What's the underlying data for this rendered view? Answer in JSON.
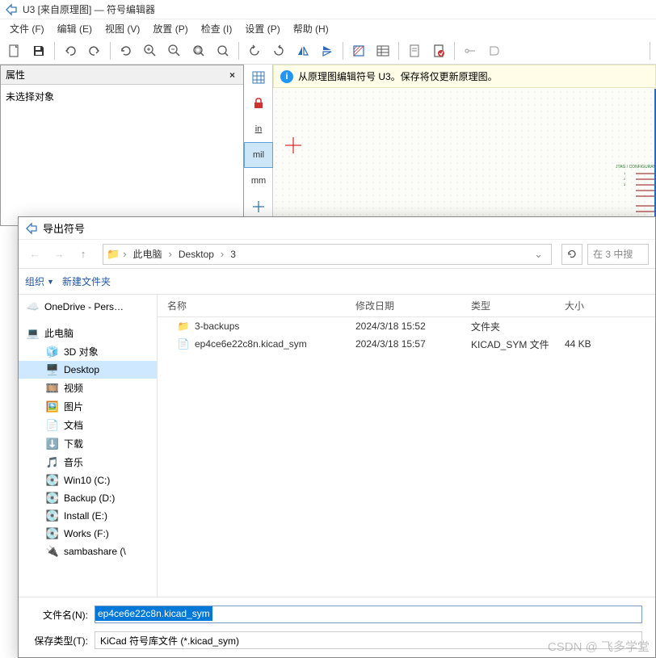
{
  "window": {
    "title": "U3 [来自原理图] — 符号编辑器"
  },
  "menu": {
    "file": "文件 (F)",
    "edit": "编辑 (E)",
    "view": "视图 (V)",
    "place": "放置 (P)",
    "inspect": "检查 (I)",
    "preferences": "设置 (P)",
    "help": "帮助 (H)"
  },
  "props_panel": {
    "title": "属性",
    "body": "未选择对象"
  },
  "canvas_toolbar": {
    "in": "in",
    "mil": "mil",
    "mm": "mm"
  },
  "info_banner": "从原理图编辑符号 U3。保存将仅更新原理图。",
  "dialog": {
    "title": "导出符号",
    "breadcrumb": {
      "root": "此电脑",
      "items": [
        "Desktop",
        "3"
      ]
    },
    "search_placeholder": "在 3 中搜",
    "toolbar": {
      "organize": "组织",
      "new_folder": "新建文件夹"
    },
    "nav_tree": [
      {
        "id": "onedrive",
        "label": "OneDrive - Pers…",
        "icon": "cloud",
        "root": true
      },
      {
        "id": "this-pc",
        "label": "此电脑",
        "icon": "pc",
        "root": true
      },
      {
        "id": "3d",
        "label": "3D 对象",
        "icon": "cube"
      },
      {
        "id": "desktop",
        "label": "Desktop",
        "icon": "desktop",
        "selected": true
      },
      {
        "id": "videos",
        "label": "视频",
        "icon": "video"
      },
      {
        "id": "pictures",
        "label": "图片",
        "icon": "picture"
      },
      {
        "id": "documents",
        "label": "文档",
        "icon": "doc"
      },
      {
        "id": "downloads",
        "label": "下载",
        "icon": "download"
      },
      {
        "id": "music",
        "label": "音乐",
        "icon": "music"
      },
      {
        "id": "c",
        "label": "Win10 (C:)",
        "icon": "drive"
      },
      {
        "id": "d",
        "label": "Backup (D:)",
        "icon": "drive"
      },
      {
        "id": "e",
        "label": "Install (E:)",
        "icon": "drive"
      },
      {
        "id": "f",
        "label": "Works (F:)",
        "icon": "drive"
      },
      {
        "id": "smb",
        "label": "sambashare (\\",
        "icon": "netdrive"
      }
    ],
    "list_headers": {
      "name": "名称",
      "date": "修改日期",
      "type": "类型",
      "size": "大小"
    },
    "files": [
      {
        "name": "3-backups",
        "date": "2024/3/18 15:52",
        "type": "文件夹",
        "size": "",
        "icon": "folder"
      },
      {
        "name": "ep4ce6e22c8n.kicad_sym",
        "date": "2024/3/18 15:57",
        "type": "KICAD_SYM 文件",
        "size": "44 KB",
        "icon": "file"
      }
    ],
    "footer": {
      "filename_label": "文件名(N):",
      "filename_value": "ep4ce6e22c8n.kicad_sym",
      "filetype_label": "保存类型(T):",
      "filetype_value": "KiCad 符号库文件 (*.kicad_sym)"
    }
  },
  "watermark": "CSDN @ 飞多学堂"
}
